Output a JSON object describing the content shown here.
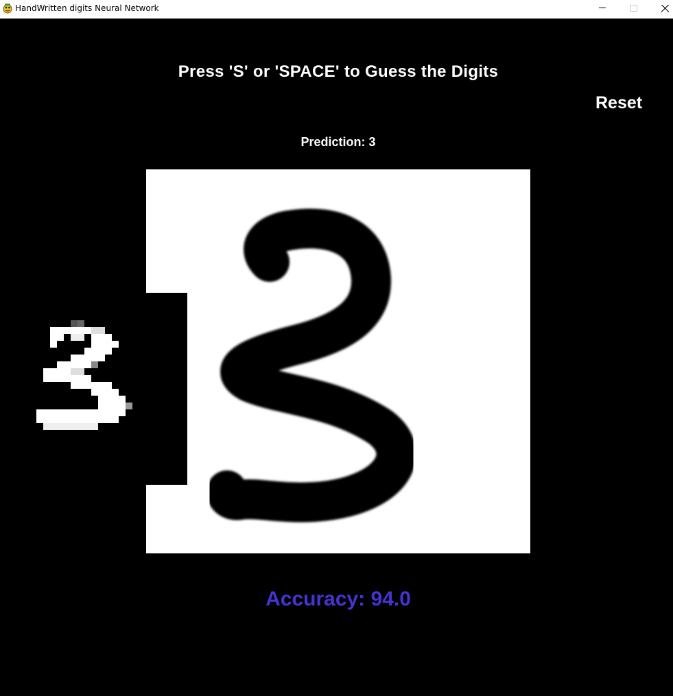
{
  "window": {
    "title": "HandWritten digits Neural Network",
    "icon": "pygame-snake-icon",
    "controls": [
      "minimize-icon",
      "maximize-icon",
      "close-icon"
    ]
  },
  "app": {
    "instruction": "Press 'S' or 'SPACE' to Guess the Digits",
    "reset_label": "Reset",
    "prediction_text": "Prediction: 3",
    "accuracy_text": "Accuracy: 94.0"
  },
  "colors": {
    "background": "#000000",
    "text": "#ffffff",
    "canvas": "#ffffff",
    "stroke": "#000000",
    "accuracy": "#4434d4"
  }
}
